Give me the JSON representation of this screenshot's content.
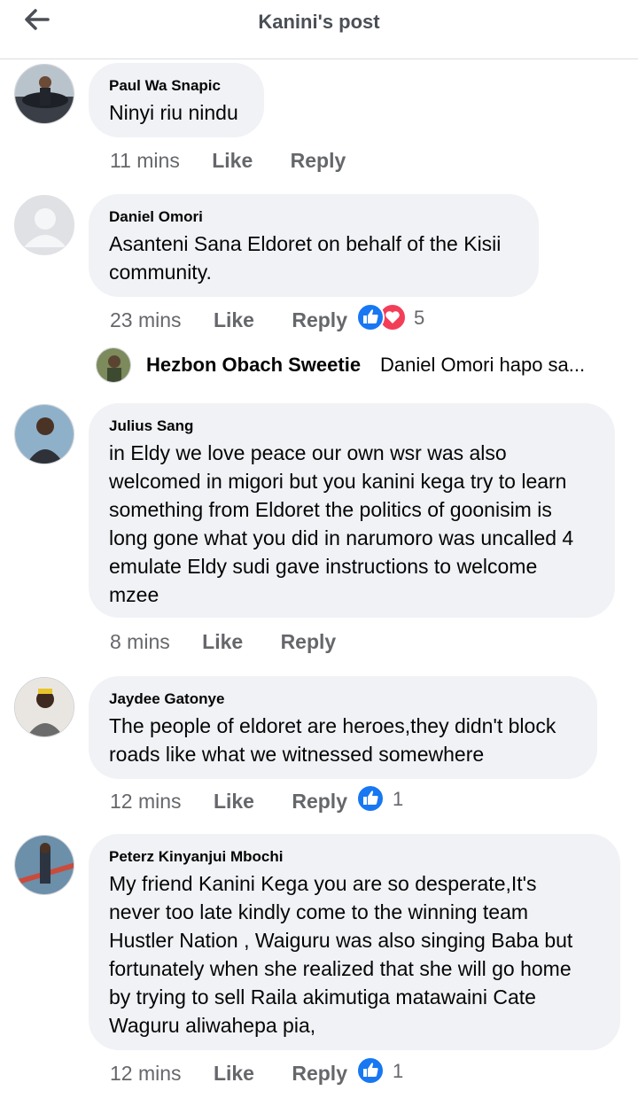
{
  "header": {
    "title": "Kanini's post",
    "back_icon": "arrow-left-icon"
  },
  "comments": [
    {
      "author": "Paul Wa Snapic",
      "lines": [
        "Ninyi riu nindu"
      ],
      "time": "11 mins",
      "like": "Like",
      "reply": "Reply"
    },
    {
      "author": "Daniel Omori",
      "lines": [
        "Asanteni Sana Eldoret on behalf of the Kisii",
        "community."
      ],
      "time": "23 mins",
      "like": "Like",
      "reply": "Reply",
      "reactions": {
        "icons": [
          "like-icon",
          "love-icon"
        ],
        "count": "5"
      }
    },
    {
      "author": "Julius Sang",
      "lines": [
        "in Eldy we love peace our own wsr was also",
        "welcomed in migori but you kanini kega try to learn",
        "something from Eldoret the politics of goonisim is",
        "long gone what you did in narumoro was uncalled 4",
        "emulate Eldy sudi gave instructions to welcome",
        "mzee"
      ],
      "time": "8 mins",
      "like": "Like",
      "reply": "Reply"
    },
    {
      "author": "Jaydee Gatonye",
      "lines": [
        "The people of eldoret are heroes,they didn't block",
        "roads like what we witnessed somewhere"
      ],
      "time": "12 mins",
      "like": "Like",
      "reply": "Reply",
      "reactions": {
        "icons": [
          "like-icon"
        ],
        "count": "1"
      }
    },
    {
      "author": "Peterz Kinyanjui Mbochi",
      "lines": [
        "My friend Kanini Kega you are so desperate,It's",
        "never too late kindly come to the winning team",
        "Hustler Nation , Waiguru was also singing Baba but",
        "fortunately  when she realized that she will go home",
        "by trying to sell Raila  akimutiga matawaini  Cate",
        "Waguru aliwahepa pia,"
      ],
      "time": "12 mins",
      "like": "Like",
      "reply": "Reply",
      "reactions": {
        "icons": [
          "like-icon"
        ],
        "count": "1"
      }
    }
  ],
  "reply_preview": {
    "author": "Hezbon Obach Sweetie",
    "text": "Daniel Omori hapo sa..."
  },
  "colors": {
    "bubble": "#f0f2f5",
    "meta": "#65676b",
    "like_blue": "#1877f2",
    "love_red": "#f33e58"
  }
}
